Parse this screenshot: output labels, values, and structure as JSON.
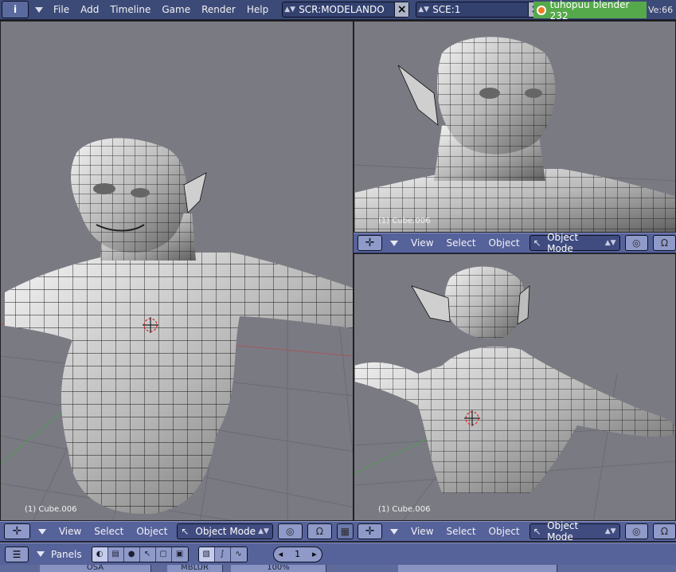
{
  "topbar": {
    "info_icon": "info-icon",
    "menus": [
      "File",
      "Add",
      "Timeline",
      "Game",
      "Render",
      "Help"
    ],
    "screen": "SCR:MODELANDO",
    "scene": "SCE:1",
    "title": "tuhopuu blender 232",
    "version": "Ve:66"
  },
  "viewports": {
    "main": {
      "object_label": "(1) Cube.006"
    },
    "top_right": {
      "object_label": "(1) Cube.006"
    },
    "bottom_right": {
      "object_label": "(1) Cube.006"
    }
  },
  "view3d_header": {
    "menus": [
      "View",
      "Select",
      "Object"
    ],
    "mode": "Object Mode",
    "editor_icon": "crosshair-icon",
    "pivot_icon": "pivot-icon",
    "snap_icon": "magnet-icon"
  },
  "buttons_header": {
    "label": "Panels",
    "frame": "1",
    "context_icons": [
      "logic-icon",
      "script-icon",
      "shading-icon",
      "object-icon",
      "editing-icon",
      "scene-icon"
    ],
    "sub_icons": [
      "render-icon",
      "anim-icon",
      "sound-icon"
    ]
  },
  "footer": {
    "osa": "OSA",
    "mblur": "MBLUR",
    "percent": "100%"
  },
  "colors": {
    "viewport_bg": "#7a7a83",
    "header_bg": "#56629a",
    "topbar_bg": "#3c4a78",
    "title_green": "#55a94a",
    "mesh_fill": "#d9d9d9",
    "mesh_wire": "#000000"
  }
}
